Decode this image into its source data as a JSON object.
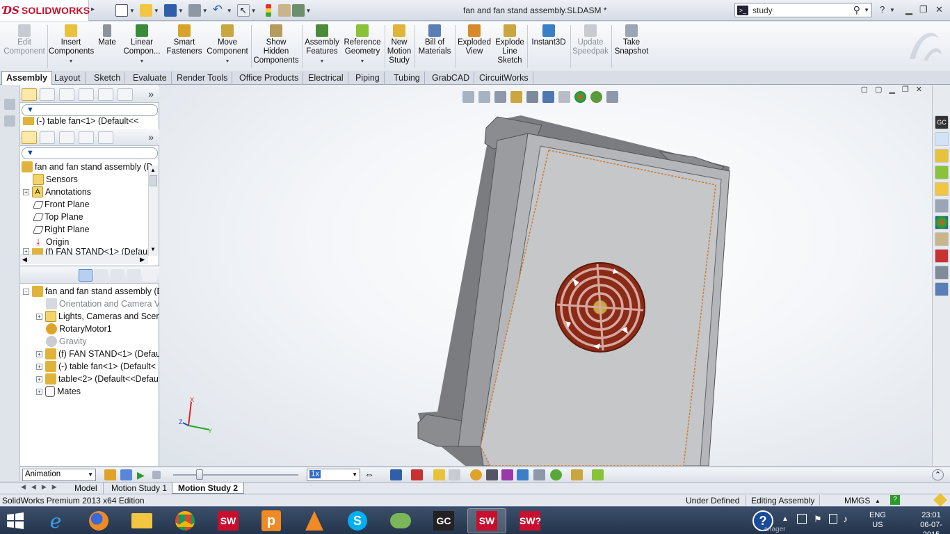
{
  "app": {
    "logo_brand": "SOLIDWORKS",
    "document_title": "fan and fan stand assembly.SLDASM *",
    "search_value": "study",
    "help_label": "?"
  },
  "command_manager": {
    "items": [
      {
        "label": "Edit\nComponent",
        "disabled": true
      },
      {
        "label": "Insert\nComponents",
        "disabled": false
      },
      {
        "label": "Mate",
        "disabled": false
      },
      {
        "label": "Linear\nCompon...",
        "disabled": false
      },
      {
        "label": "Smart\nFasteners",
        "disabled": false
      },
      {
        "label": "Move\nComponent",
        "disabled": false
      },
      {
        "label": "Show\nHidden\nComponents",
        "disabled": false
      },
      {
        "label": "Assembly\nFeatures",
        "disabled": false
      },
      {
        "label": "Reference\nGeometry",
        "disabled": false
      },
      {
        "label": "New\nMotion\nStudy",
        "disabled": false
      },
      {
        "label": "Bill of\nMaterials",
        "disabled": false
      },
      {
        "label": "Exploded\nView",
        "disabled": false
      },
      {
        "label": "Explode\nLine\nSketch",
        "disabled": false
      },
      {
        "label": "Instant3D",
        "disabled": false
      },
      {
        "label": "Update\nSpeedpak",
        "disabled": true
      },
      {
        "label": "Take\nSnapshot",
        "disabled": false
      }
    ]
  },
  "tabs": [
    "Assembly",
    "Layout",
    "Sketch",
    "Evaluate",
    "Render Tools",
    "Office Products",
    "Electrical",
    "Piping",
    "Tubing",
    "GrabCAD",
    "CircuitWorks"
  ],
  "feature_tree_top": {
    "collapsed_item": "(-) table fan<1> (Default<<"
  },
  "feature_tree": {
    "items": [
      {
        "label": "fan and fan stand assembly  (D",
        "level": 0,
        "expander": ""
      },
      {
        "label": "Sensors",
        "level": 1,
        "expander": ""
      },
      {
        "label": "Annotations",
        "level": 1,
        "expander": "+"
      },
      {
        "label": "Front Plane",
        "level": 1,
        "expander": ""
      },
      {
        "label": "Top Plane",
        "level": 1,
        "expander": ""
      },
      {
        "label": "Right Plane",
        "level": 1,
        "expander": ""
      },
      {
        "label": "Origin",
        "level": 1,
        "expander": ""
      },
      {
        "label": "(f) FAN STAND<1> (Default",
        "level": 1,
        "expander": "+"
      }
    ]
  },
  "motion_tree": {
    "items": [
      {
        "label": "fan and fan stand assembly  (D",
        "level": 0,
        "expander": "-",
        "gray": false
      },
      {
        "label": "Orientation and Camera V",
        "level": 1,
        "expander": "",
        "gray": true
      },
      {
        "label": "Lights, Cameras and Scene",
        "level": 1,
        "expander": "+",
        "gray": false
      },
      {
        "label": "RotaryMotor1",
        "level": 1,
        "expander": "",
        "gray": false
      },
      {
        "label": "Gravity",
        "level": 1,
        "expander": "",
        "gray": true
      },
      {
        "label": "(f) FAN STAND<1> (Defau",
        "level": 1,
        "expander": "+",
        "gray": false
      },
      {
        "label": "(-) table fan<1> (Default<",
        "level": 1,
        "expander": "+",
        "gray": false
      },
      {
        "label": "table<2> (Default<<Defau",
        "level": 1,
        "expander": "+",
        "gray": false
      },
      {
        "label": "Mates",
        "level": 1,
        "expander": "+",
        "gray": false
      }
    ]
  },
  "triad": {
    "x": "X",
    "y": "Y",
    "z": "Z"
  },
  "motion_bar": {
    "study_type": "Animation",
    "playback_speed": "1x"
  },
  "model_tabs": [
    "Model",
    "Motion Study 1",
    "Motion Study 2"
  ],
  "status_bar": {
    "edition": "SolidWorks Premium 2013 x64 Edition",
    "state": "Under Defined",
    "mode": "Editing Assembly",
    "units": "MMGS",
    "units_arrow": "▲",
    "help": "?"
  },
  "taskbar": {
    "apps": [
      "internet-explorer",
      "firefox",
      "file-explorer",
      "chrome",
      "solidworks",
      "pinnacle",
      "vlc",
      "skype",
      "network",
      "grabcad",
      "solidworks-active",
      "solidworks-help"
    ],
    "tray_hint": "...anager",
    "language": "ENG",
    "region": "US",
    "time": "23:01",
    "date": "06-07-2015"
  },
  "colors": {
    "brand_red": "#c8102e",
    "fan_red": "#b7361f",
    "accent_blue": "#3169c6"
  }
}
